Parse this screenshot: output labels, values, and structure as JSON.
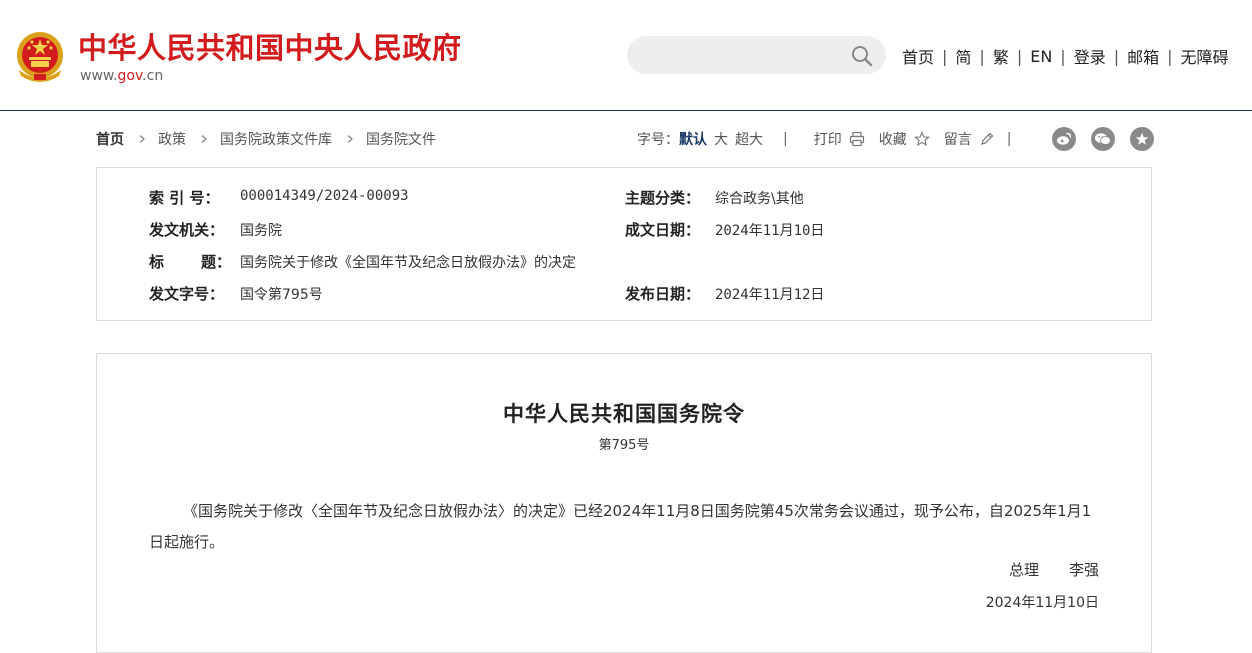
{
  "header": {
    "site_title": "中华人民共和国中央人民政府",
    "domain_prefix": "www.",
    "domain_mid": "gov",
    "domain_suffix": ".cn",
    "search": {
      "value": "",
      "placeholder": ""
    },
    "nav": [
      "首页",
      "简",
      "繁",
      "EN",
      "登录",
      "邮箱",
      "无障碍"
    ],
    "nav_separator": "|"
  },
  "breadcrumb": [
    "首页",
    "政策",
    "国务院政策文件库",
    "国务院文件"
  ],
  "toolbar": {
    "font_size_label": "字号：",
    "font_default": "默认",
    "font_large": "大",
    "font_xlarge": "超大",
    "separator": "|",
    "print": "打印",
    "favorite": "收藏",
    "comment": "留言"
  },
  "social": [
    "weibo-icon",
    "wechat-icon",
    "favorite-star-icon"
  ],
  "info": {
    "index_label": "索 引 号：",
    "index_value": "000014349/2024-00093",
    "topic_label": "主题分类：",
    "topic_value": "综合政务\\其他",
    "issuer_label": "发文机关：",
    "issuer_value": "国务院",
    "created_label": "成文日期：",
    "created_value": "2024年11月10日",
    "title_label_a": "标",
    "title_label_b": "题：",
    "title_value": "国务院关于修改《全国年节及纪念日放假办法》的决定",
    "docnum_label": "发文字号：",
    "docnum_value": "国令第795号",
    "published_label": "发布日期：",
    "published_value": "2024年11月12日"
  },
  "article": {
    "title": "中华人民共和国国务院令",
    "number": "第795号",
    "paragraph": "《国务院关于修改〈全国年节及纪念日放假办法〉的决定》已经2024年11月8日国务院第45次常务会议通过，现予公布，自2025年1月1日起施行。",
    "signer_title": "总理",
    "signer_name": "李强",
    "sign_date": "2024年11月10日"
  },
  "colors": {
    "brand_red": "#d21b1c",
    "nav_blue": "#1b3a66",
    "border_gray": "#dcdcdc"
  }
}
